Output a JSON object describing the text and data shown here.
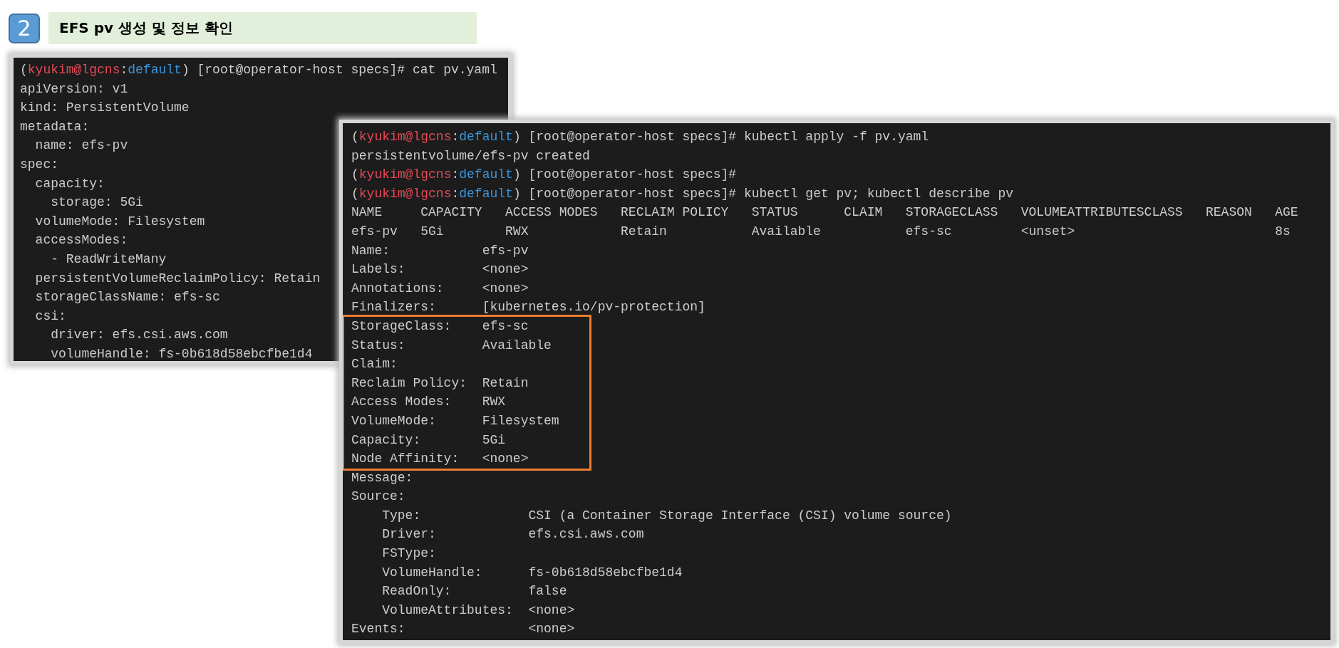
{
  "header": {
    "step": "2",
    "title": "EFS pv 생성 및 정보 확인"
  },
  "terminals": [
    {
      "sections": [
        {
          "kind": "plain",
          "lines": [
            {
              "kind": "prompt",
              "open": "(",
              "user": "kyukim@lgcns",
              "sep": ":",
              "context": "default",
              "rest": ") [root@operator-host specs]# cat pv.yaml"
            },
            {
              "kind": "text",
              "text": "apiVersion: v1"
            },
            {
              "kind": "text",
              "text": "kind: PersistentVolume"
            },
            {
              "kind": "text",
              "text": "metadata:"
            },
            {
              "kind": "text",
              "text": "  name: efs-pv"
            },
            {
              "kind": "text",
              "text": "spec:"
            },
            {
              "kind": "text",
              "text": "  capacity:"
            },
            {
              "kind": "text",
              "text": "    storage: 5Gi"
            },
            {
              "kind": "text",
              "text": "  volumeMode: Filesystem"
            },
            {
              "kind": "text",
              "text": "  accessModes:"
            },
            {
              "kind": "text",
              "text": "    - ReadWriteMany"
            },
            {
              "kind": "text",
              "text": "  persistentVolumeReclaimPolicy: Retain"
            },
            {
              "kind": "text",
              "text": "  storageClassName: efs-sc"
            },
            {
              "kind": "text",
              "text": "  csi:"
            },
            {
              "kind": "text",
              "text": "    driver: efs.csi.aws.com"
            },
            {
              "kind": "text",
              "text": "    volumeHandle: fs-0b618d58ebcfbe1d4"
            }
          ]
        }
      ]
    },
    {
      "sections": [
        {
          "kind": "plain",
          "lines": [
            {
              "kind": "prompt",
              "open": "(",
              "user": "kyukim@lgcns",
              "sep": ":",
              "context": "default",
              "rest": ") [root@operator-host specs]# kubectl apply -f pv.yaml"
            },
            {
              "kind": "text",
              "text": "persistentvolume/efs-pv created"
            },
            {
              "kind": "prompt",
              "open": "(",
              "user": "kyukim@lgcns",
              "sep": ":",
              "context": "default",
              "rest": ") [root@operator-host specs]#"
            },
            {
              "kind": "prompt",
              "open": "(",
              "user": "kyukim@lgcns",
              "sep": ":",
              "context": "default",
              "rest": ") [root@operator-host specs]# kubectl get pv; kubectl describe pv"
            },
            {
              "kind": "text",
              "text": "NAME     CAPACITY   ACCESS MODES   RECLAIM POLICY   STATUS      CLAIM   STORAGECLASS   VOLUMEATTRIBUTESCLASS   REASON   AGE"
            },
            {
              "kind": "text",
              "text": "efs-pv   5Gi        RWX            Retain           Available           efs-sc         <unset>                          8s"
            },
            {
              "kind": "text",
              "text": "Name:            efs-pv"
            },
            {
              "kind": "text",
              "text": "Labels:          <none>"
            },
            {
              "kind": "text",
              "text": "Annotations:     <none>"
            },
            {
              "kind": "text",
              "text": "Finalizers:      [kubernetes.io/pv-protection]"
            }
          ]
        },
        {
          "kind": "highlighted",
          "lines": [
            {
              "kind": "text",
              "text": "StorageClass:    efs-sc"
            },
            {
              "kind": "text",
              "text": "Status:          Available"
            },
            {
              "kind": "text",
              "text": "Claim:"
            },
            {
              "kind": "text",
              "text": "Reclaim Policy:  Retain"
            },
            {
              "kind": "text",
              "text": "Access Modes:    RWX"
            },
            {
              "kind": "text",
              "text": "VolumeMode:      Filesystem"
            },
            {
              "kind": "text",
              "text": "Capacity:        5Gi"
            },
            {
              "kind": "text",
              "text": "Node Affinity:   <none>"
            }
          ]
        },
        {
          "kind": "plain",
          "lines": [
            {
              "kind": "text",
              "text": "Message:"
            },
            {
              "kind": "text",
              "text": "Source:"
            },
            {
              "kind": "text",
              "text": "    Type:              CSI (a Container Storage Interface (CSI) volume source)"
            },
            {
              "kind": "text",
              "text": "    Driver:            efs.csi.aws.com"
            },
            {
              "kind": "text",
              "text": "    FSType:"
            },
            {
              "kind": "text",
              "text": "    VolumeHandle:      fs-0b618d58ebcfbe1d4"
            },
            {
              "kind": "text",
              "text": "    ReadOnly:          false"
            },
            {
              "kind": "text",
              "text": "    VolumeAttributes:  <none>"
            },
            {
              "kind": "text",
              "text": "Events:                <none>"
            }
          ]
        }
      ]
    }
  ]
}
